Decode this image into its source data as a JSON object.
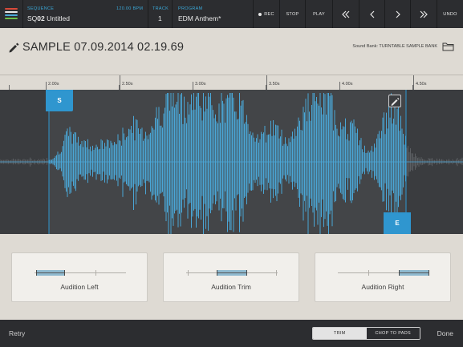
{
  "topbar": {
    "sequence_label": "SEQUENCE",
    "bpm": "120.00 BPM",
    "sequence_prefix": "SQ",
    "sequence_num": "02",
    "sequence_name": "Untitled",
    "track_label": "TRACK",
    "track_value": "1",
    "program_label": "PROGRAM",
    "program_value": "EDM Anthem*",
    "rec_label": "REC",
    "stop_label": "STOP",
    "play_label": "PLAY",
    "undo_label": "UNDO",
    "logo_colors": [
      "#d94a3a",
      "#e8e8e8",
      "#4aa8d8",
      "#e8e8e8",
      "#6cc04a"
    ]
  },
  "header": {
    "title": "SAMPLE 07.09.2014 02.19.69",
    "sound_bank": "Sound Bank: TURNTABLE SAMPLE BANK"
  },
  "ruler": {
    "labels": [
      "2.00s",
      "2.50s",
      "3.00s",
      "3.50s",
      "4.00s",
      "4.50s"
    ]
  },
  "waveform": {
    "start_marker": "S",
    "end_marker": "E",
    "accent_color": "#2f96cf",
    "wave_color": "#4aa6d6"
  },
  "audition": {
    "left_label": "Audition Left",
    "trim_label": "Audition Trim",
    "right_label": "Audition Right"
  },
  "bottombar": {
    "retry_label": "Retry",
    "trim_label": "TRIM",
    "chop_label": "CHOP TO PADS",
    "done_label": "Done"
  }
}
